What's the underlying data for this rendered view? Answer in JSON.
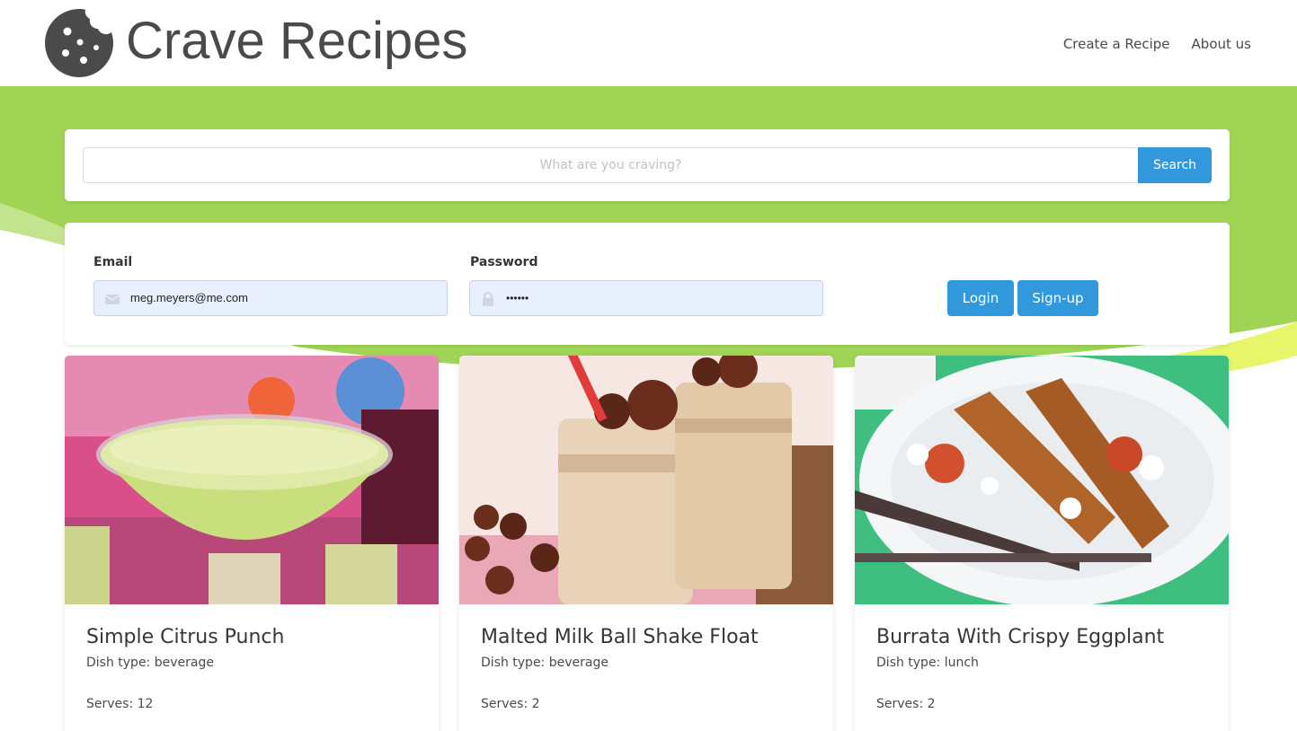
{
  "header": {
    "brand": "Crave Recipes",
    "logo_icon": "cookie-icon",
    "nav": [
      {
        "label": "Create a Recipe"
      },
      {
        "label": "About us"
      }
    ]
  },
  "colors": {
    "hero_green": "#a0d454",
    "accent_blue": "#3298dc",
    "autofill_bg": "#e8f0fe"
  },
  "search": {
    "placeholder": "What are you craving?",
    "button_label": "Search"
  },
  "login": {
    "email_label": "Email",
    "email_value": "meg.meyers@me.com",
    "email_icon": "envelope-icon",
    "password_label": "Password",
    "password_value": "••••••",
    "password_icon": "lock-icon",
    "login_label": "Login",
    "signup_label": "Sign-up"
  },
  "recipes": [
    {
      "title": "Simple Citrus Punch",
      "dish_type": "Dish type: beverage",
      "serves": "Serves: 12"
    },
    {
      "title": "Malted Milk Ball Shake Float",
      "dish_type": "Dish type: beverage",
      "serves": "Serves: 2"
    },
    {
      "title": "Burrata With Crispy Eggplant",
      "dish_type": "Dish type: lunch",
      "serves": "Serves: 2"
    }
  ]
}
